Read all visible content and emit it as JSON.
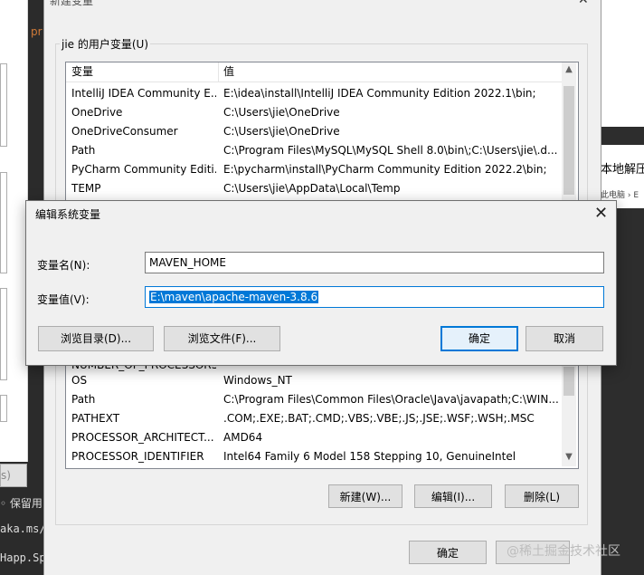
{
  "background": {
    "left_texts": [
      "◦ 保留用",
      "aka.ms/",
      "Happ.Sp"
    ],
    "left_orange": "pr",
    "left_button": "s)",
    "right_title": "本地解压",
    "right_crumb": "此电脑 › E"
  },
  "env_dialog": {
    "title": "新建变量",
    "close": "✕",
    "user_group_label": "jie 的用户变量(U)",
    "columns": [
      "变量",
      "值"
    ],
    "user_vars": [
      {
        "name": "IntelliJ IDEA Community E...",
        "value": "E:\\idea\\install\\IntelliJ IDEA Community Edition 2022.1\\bin;"
      },
      {
        "name": "OneDrive",
        "value": "C:\\Users\\jie\\OneDrive"
      },
      {
        "name": "OneDriveConsumer",
        "value": "C:\\Users\\jie\\OneDrive"
      },
      {
        "name": "Path",
        "value": "C:\\Program Files\\MySQL\\MySQL Shell 8.0\\bin\\;C:\\Users\\jie\\.d..."
      },
      {
        "name": "PyCharm Community Editi...",
        "value": "E:\\pycharm\\install\\PyCharm Community Edition 2022.2\\bin;"
      },
      {
        "name": "TEMP",
        "value": "C:\\Users\\jie\\AppData\\Local\\Temp"
      }
    ],
    "system_vars": [
      {
        "name": "NUMBER_OF_PROCESSORS",
        "value": ""
      },
      {
        "name": "OS",
        "value": "Windows_NT"
      },
      {
        "name": "Path",
        "value": "C:\\Program Files\\Common Files\\Oracle\\Java\\javapath;C:\\WIN..."
      },
      {
        "name": "PATHEXT",
        "value": ".COM;.EXE;.BAT;.CMD;.VBS;.VBE;.JS;.JSE;.WSF;.WSH;.MSC"
      },
      {
        "name": "PROCESSOR_ARCHITECT...",
        "value": "AMD64"
      },
      {
        "name": "PROCESSOR_IDENTIFIER",
        "value": "Intel64 Family 6 Model 158 Stepping 10, GenuineIntel"
      }
    ],
    "buttons": {
      "new": "新建(W)...",
      "edit": "编辑(I)...",
      "delete": "删除(L)",
      "ok": "确定"
    }
  },
  "edit_dialog": {
    "title": "编辑系统变量",
    "close": "✕",
    "name_label": "变量名(N):",
    "name_value": "MAVEN_HOME",
    "value_label": "变量值(V):",
    "value_value": "E:\\maven\\apache-maven-3.8.6",
    "browse_dir": "浏览目录(D)...",
    "browse_file": "浏览文件(F)...",
    "ok": "确定",
    "cancel": "取消"
  },
  "watermark": "@稀土掘金技术社区"
}
